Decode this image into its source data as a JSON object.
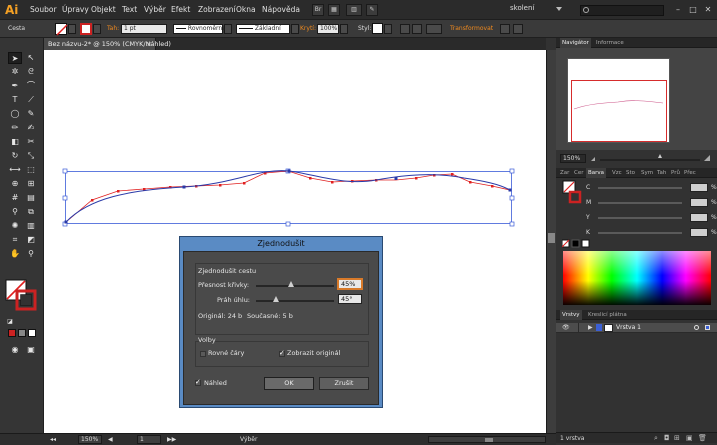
{
  "app": {
    "logo": "Ai",
    "menu": [
      "Soubor",
      "Úpravy",
      "Objekt",
      "Text",
      "Výběr",
      "Efekt",
      "Zobrazení",
      "Okna",
      "Nápověda"
    ],
    "bridge_label": "Br",
    "workspace": "skolení",
    "window_controls": [
      "–",
      "□",
      "✕"
    ]
  },
  "controlbar": {
    "object_type": "Cesta",
    "stroke_label": "Tah:",
    "stroke_weight": "1 pt",
    "stroke_profile": "Rovnoměrné",
    "brush": "Základní",
    "opacity_label": "Krytí:",
    "opacity": "100%",
    "style_label": "Styl:",
    "transform_label": "Transformovat"
  },
  "document": {
    "tab_title": "Bez názvu-2* @ 150% (CMYK/Náhled)",
    "close": "×"
  },
  "dialog": {
    "title": "Zjednodušit",
    "group_title": "Zjednodušit cestu",
    "curve_precision_label": "Přesnost křivky:",
    "curve_precision_value": "45%",
    "curve_precision_fraction": 0.45,
    "angle_threshold_label": "Práh úhlu:",
    "angle_threshold_value": "45°",
    "angle_threshold_fraction": 0.25,
    "original_label": "Originál: 24 b",
    "current_label": "Současné: 5 b",
    "options_title": "Volby",
    "straight_lines_label": "Rovné čáry",
    "straight_lines_checked": false,
    "show_original_label": "Zobrazit originál",
    "show_original_checked": true,
    "preview_label": "Náhled",
    "preview_checked": true,
    "ok_label": "OK",
    "cancel_label": "Zrušit"
  },
  "navigator": {
    "tabs": [
      "Navigátor",
      "Informace"
    ],
    "zoom": "150%"
  },
  "color_panel": {
    "tabs": [
      "Zar",
      "Cer",
      "Barva",
      "Vzc",
      "Sto",
      "Sym",
      "Tah",
      "Prů",
      "Přec"
    ],
    "channels": [
      {
        "name": "C",
        "pct": "%"
      },
      {
        "name": "M",
        "pct": "%"
      },
      {
        "name": "Y",
        "pct": "%"
      },
      {
        "name": "K",
        "pct": "%"
      }
    ]
  },
  "layers": {
    "tabs": [
      "Vrstvy",
      "Kreslicí plátna"
    ],
    "layer_name": "Vrstva 1",
    "footer_count": "1 vrstva"
  },
  "statusbar": {
    "zoom": "150%",
    "page": "1",
    "mode": "Výběr"
  },
  "colors": {
    "accent_orange": "#f08a1e",
    "dialog_blue": "#5a8bc4",
    "path_red": "#e02020",
    "path_blue": "#2a3aa8"
  }
}
